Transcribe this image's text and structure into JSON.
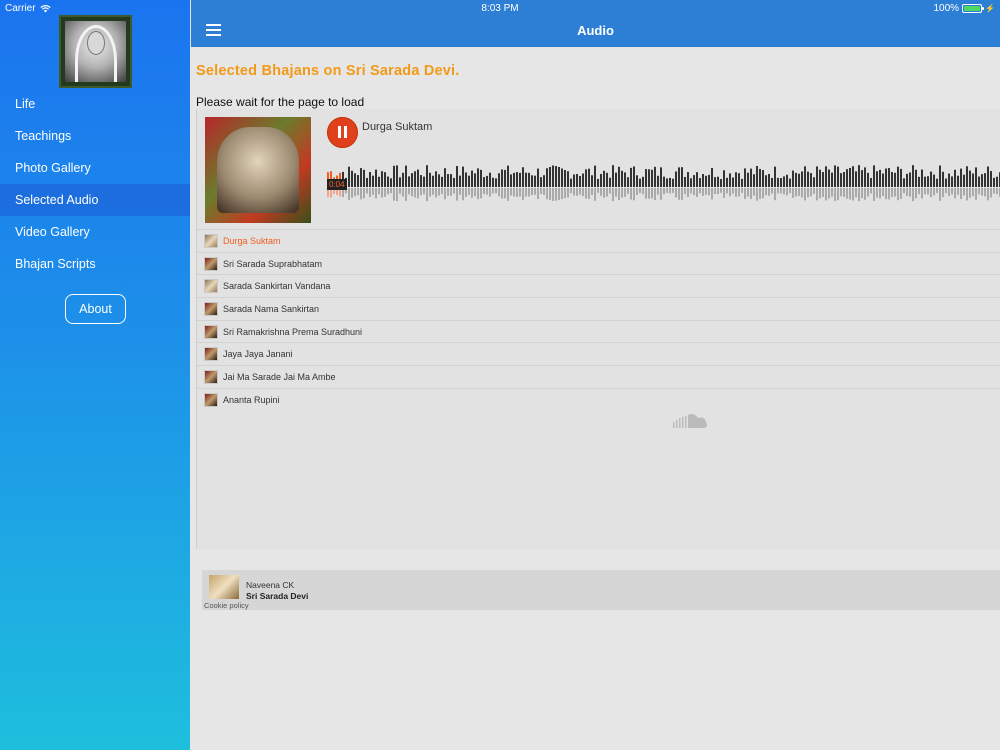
{
  "status_bar": {
    "carrier": "Carrier",
    "time": "8:03 PM",
    "battery": "100%"
  },
  "sidebar": {
    "items": [
      {
        "label": "Life",
        "active": false
      },
      {
        "label": "Teachings",
        "active": false
      },
      {
        "label": "Photo Gallery",
        "active": false
      },
      {
        "label": "Selected Audio",
        "active": true
      },
      {
        "label": "Video Gallery",
        "active": false
      },
      {
        "label": "Bhajan Scripts",
        "active": false
      }
    ],
    "about_label": "About"
  },
  "navbar": {
    "title": "Audio",
    "menu_icon": "hamburger-icon"
  },
  "main": {
    "heading": "Selected Bhajans on Sri Sarada Devi.",
    "wait_text": "Please wait for the page to load"
  },
  "player": {
    "current_track": "Durga Suktam",
    "elapsed": "0:04",
    "tracks": [
      "Durga Suktam",
      "Sri Sarada Suprabhatam",
      "Sarada Sankirtan Vandana",
      "Sarada Nama Sankirtan",
      "Sri Ramakrishna Prema Suradhuni",
      "Jaya Jaya Janani",
      "Jai Ma Sarade Jai Ma Ambe",
      "Ananta Rupini"
    ],
    "user": "Naveena CK",
    "playlist": "Sri Sarada Devi",
    "cookie_policy": "Cookie policy",
    "colors": {
      "accent": "#f05d1e",
      "heading": "#f29a17",
      "navbar": "#2d7fd6"
    }
  }
}
